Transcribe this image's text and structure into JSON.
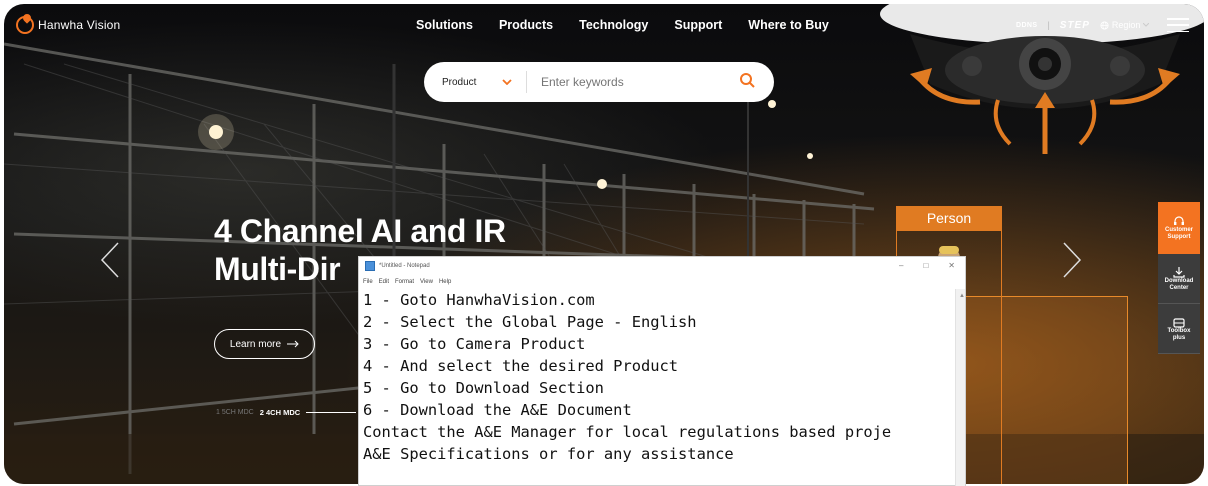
{
  "header": {
    "logo_text": "Hanwha Vision",
    "nav": [
      "Solutions",
      "Products",
      "Technology",
      "Support",
      "Where to Buy"
    ],
    "ddns": "DDNS",
    "step": "STEP",
    "region": "Region"
  },
  "search": {
    "category": "Product",
    "placeholder": "Enter keywords"
  },
  "hero": {
    "title_line1": "4 Channel AI and IR",
    "title_line2": "Multi-Dir",
    "learn_more": "Learn more",
    "slide_1": "1 5CH MDC",
    "slide_2": "2 4CH MDC"
  },
  "detection": {
    "label": "Person"
  },
  "side_panel": {
    "customer_support": [
      "Customer",
      "Support"
    ],
    "download_center": [
      "Download",
      "Center"
    ],
    "toolbox": [
      "Toolbox",
      "plus"
    ]
  },
  "notepad": {
    "title": "*Untitled - Notepad",
    "menu": [
      "File",
      "Edit",
      "Format",
      "View",
      "Help"
    ],
    "lines": [
      "1 - Goto HanwhaVision.com",
      "2 - Select the Global Page - English",
      "3 - Go to Camera Product",
      "4 - And select the desired Product",
      "5 - Go to Download Section",
      "6 - Download the A&E Document",
      "",
      "Contact the A&E Manager for local regulations based proje",
      "A&E Specifications or for any assistance"
    ]
  },
  "colors": {
    "brand_orange": "#f37321",
    "detection_orange": "#e07b22"
  }
}
